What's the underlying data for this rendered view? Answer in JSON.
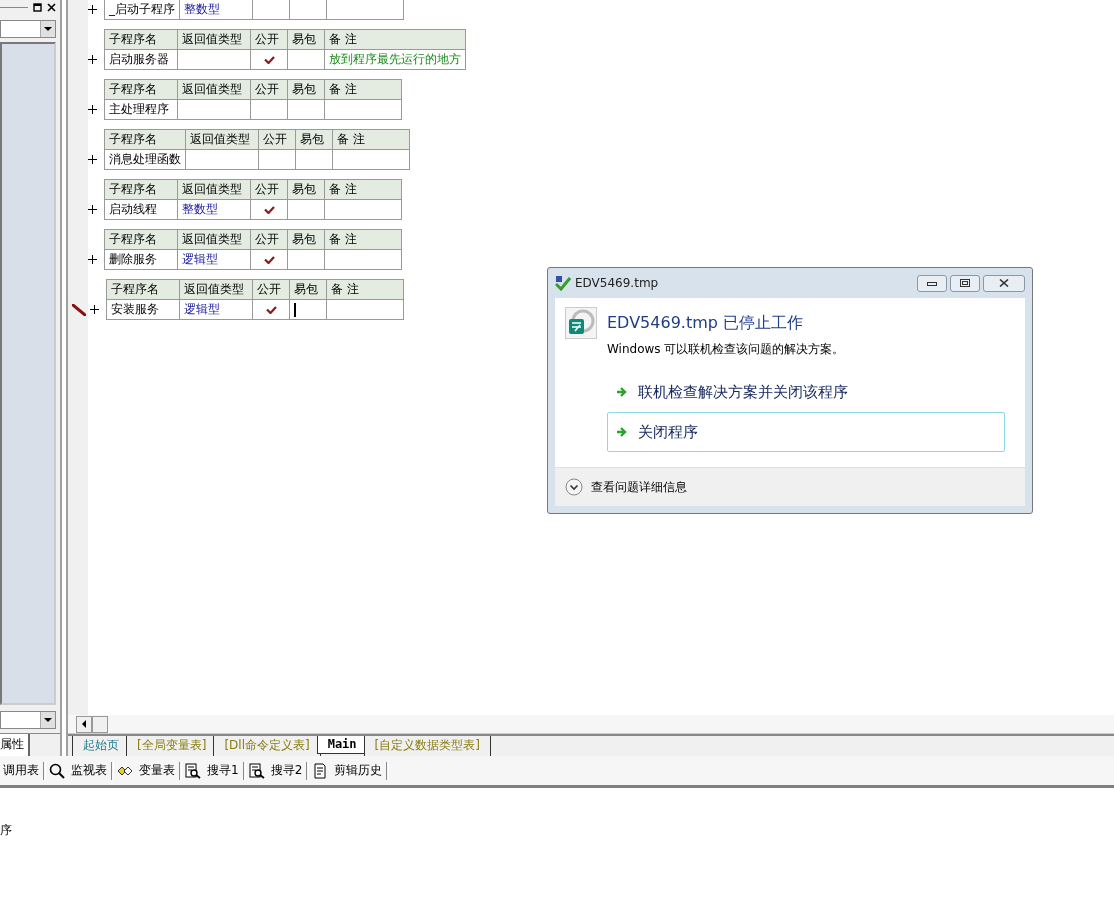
{
  "left_panel": {
    "tab": "属性"
  },
  "procedures": [
    {
      "name": "_启动子程序",
      "return_type": "整数型",
      "public": false,
      "current": false
    },
    {
      "headers": [
        "子程序名",
        "返回值类型",
        "公开",
        "易包",
        "备 注"
      ],
      "name": "启动服务器",
      "public": true,
      "remark": "放到程序最先运行的地方",
      "current": false
    },
    {
      "headers": [
        "子程序名",
        "返回值类型",
        "公开",
        "易包",
        "备 注"
      ],
      "name": "主处理程序",
      "public": false,
      "current": false
    },
    {
      "headers": [
        "子程序名",
        "返回值类型",
        "公开",
        "易包",
        "备 注"
      ],
      "name": "消息处理函数",
      "public": false,
      "current": false
    },
    {
      "headers": [
        "子程序名",
        "返回值类型",
        "公开",
        "易包",
        "备 注"
      ],
      "name": "启动线程",
      "return_type": "整数型",
      "public": true,
      "current": false
    },
    {
      "headers": [
        "子程序名",
        "返回值类型",
        "公开",
        "易包",
        "备 注"
      ],
      "name": "删除服务",
      "return_type": "逻辑型",
      "public": true,
      "current": false
    },
    {
      "headers": [
        "子程序名",
        "返回值类型",
        "公开",
        "易包",
        "备 注"
      ],
      "name": "安装服务",
      "return_type": "逻辑型",
      "public": true,
      "current": true
    }
  ],
  "editor_tabs": [
    {
      "label": "起始页",
      "selected": false,
      "kind": "start"
    },
    {
      "label": "[全局变量表]",
      "selected": false,
      "kind": "table"
    },
    {
      "label": "[Dll命令定义表]",
      "selected": false,
      "kind": "table"
    },
    {
      "label": "Main",
      "selected": true,
      "kind": "code"
    },
    {
      "label": "[自定义数据类型表]",
      "selected": false,
      "kind": "table"
    }
  ],
  "toolbar": [
    {
      "label": "调用表",
      "kind": "none"
    },
    {
      "label": "监视表",
      "kind": "search"
    },
    {
      "label": "变量表",
      "kind": "variables"
    },
    {
      "label": "搜寻1",
      "kind": "find"
    },
    {
      "label": "搜寻2",
      "kind": "find"
    },
    {
      "label": "剪辑历史",
      "kind": "clipboard"
    }
  ],
  "output": {
    "text": "序"
  },
  "dialog": {
    "title": "EDV5469.tmp",
    "heading": "EDV5469.tmp 已停止工作",
    "message": "Windows 可以联机检查该问题的解决方案。",
    "options": [
      {
        "label": "联机检查解决方案并关闭该程序",
        "selected": false
      },
      {
        "label": "关闭程序",
        "selected": true
      }
    ],
    "details": "查看问题详细信息"
  }
}
